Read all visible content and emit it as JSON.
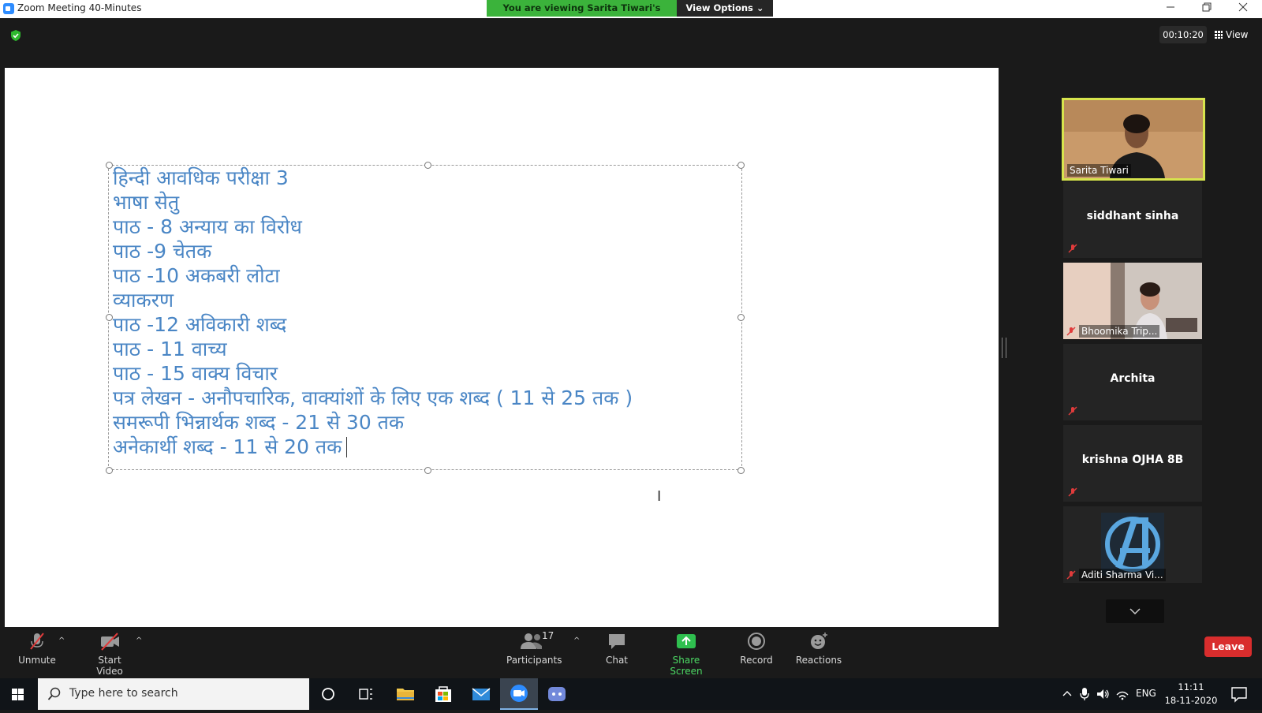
{
  "window": {
    "title": "Zoom Meeting 40-Minutes",
    "viewing_banner": "You are viewing Sarita Tiwari's screen",
    "view_options": "View Options",
    "controls": [
      "minimize",
      "restore",
      "close"
    ]
  },
  "meeting_bar": {
    "timer": "00:10:20",
    "view_label": "View"
  },
  "shared_content": {
    "lines": [
      "हिन्दी आवधिक परीक्षा 3",
      "भाषा सेतु",
      "पाठ - 8 अन्याय  का विरोध",
      "पाठ -9 चेतक",
      "पाठ -10 अकबरी लोटा",
      "व्याकरण",
      "पाठ -12 अविकारी शब्द",
      "पाठ - 11 वाच्य",
      "पाठ - 15 वाक्य विचार",
      "पत्र लेखन - अनौपचारिक, वाक्यांशों के लिए एक शब्द ( 11 से 25 तक )",
      "समरूपी भिन्नार्थक शब्द - 21 से 30 तक",
      "अनेकार्थी शब्द - 11 से 20 तक"
    ],
    "text_color": "#4a86c5"
  },
  "gallery": {
    "participants": [
      {
        "name": "Sarita Tiwari",
        "video": true,
        "active_speaker": true,
        "muted": false
      },
      {
        "name": "siddhant sinha",
        "video": false,
        "muted": true
      },
      {
        "name": "Bhoomika Trip...",
        "video": true,
        "muted": true
      },
      {
        "name": "Archita",
        "video": false,
        "muted": true
      },
      {
        "name": "krishna OJHA 8B",
        "video": false,
        "muted": true
      },
      {
        "name": "Aditi Sharma Vi...",
        "video": true,
        "muted": true
      }
    ]
  },
  "toolbar": {
    "unmute": "Unmute",
    "start_video": "Start Video",
    "participants": "Participants",
    "participants_count": "17",
    "chat": "Chat",
    "share_screen": "Share Screen",
    "record": "Record",
    "reactions": "Reactions",
    "leave": "Leave"
  },
  "taskbar": {
    "search_placeholder": "Type here to search",
    "language": "ENG",
    "time": "11:11",
    "date": "18-11-2020"
  },
  "colors": {
    "banner_green": "#3bb33b",
    "active_speaker_border": "#d7e44d",
    "leave_red": "#d92d2d",
    "share_green": "#4cd964",
    "muted_red": "#e03b3b"
  }
}
